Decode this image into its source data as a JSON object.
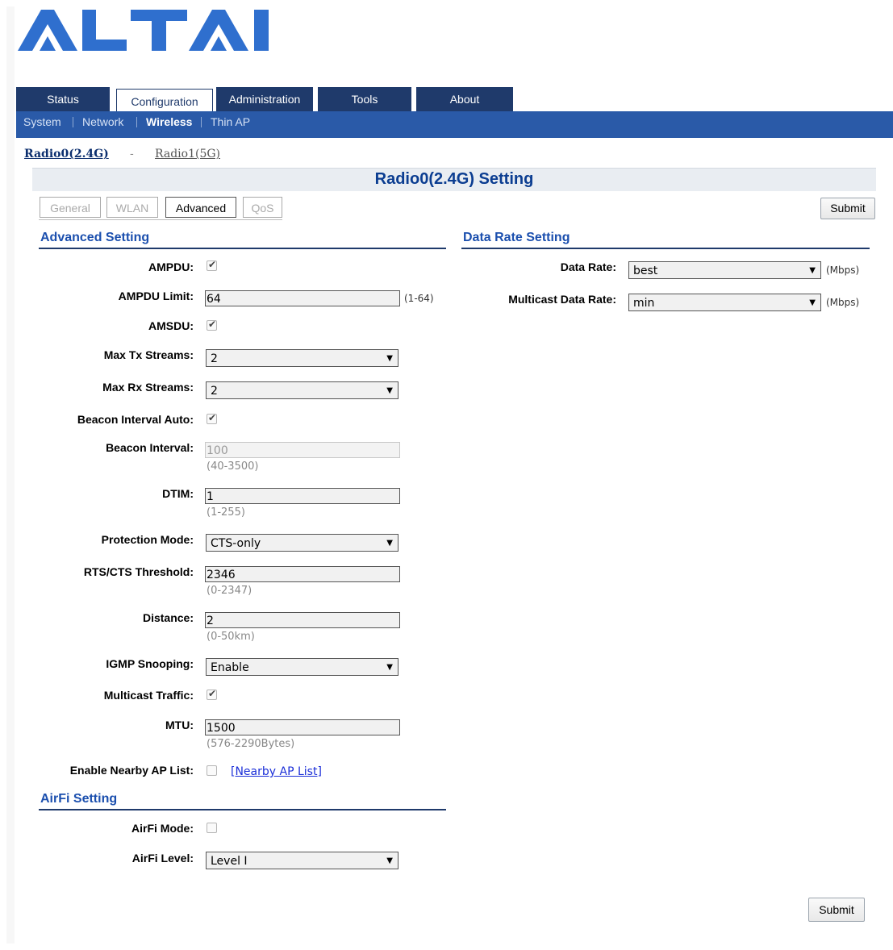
{
  "logo": {
    "text": "ALTAI",
    "color": "#2f6fce"
  },
  "main_tabs": [
    {
      "label": "Status"
    },
    {
      "label": "Configuration"
    },
    {
      "label": "Administration"
    },
    {
      "label": "Tools"
    },
    {
      "label": "About"
    }
  ],
  "active_main_tab": "Configuration",
  "sub_nav": [
    {
      "label": "System"
    },
    {
      "label": "Network"
    },
    {
      "label": "Wireless"
    },
    {
      "label": "Thin AP"
    }
  ],
  "active_sub_nav": "Wireless",
  "radio_nav": {
    "radio0": "Radio0(2.4G)",
    "separator": "-",
    "radio1": "Radio1(5G)"
  },
  "page_title": "Radio0(2.4G) Setting",
  "sub_tabs": [
    {
      "label": "General"
    },
    {
      "label": "WLAN"
    },
    {
      "label": "Advanced"
    },
    {
      "label": "QoS"
    }
  ],
  "active_sub_tab": "Advanced",
  "submit_label": "Submit",
  "advanced": {
    "heading": "Advanced Setting",
    "ampdu": {
      "label": "AMPDU:",
      "checked": true
    },
    "ampdu_limit": {
      "label": "AMPDU Limit:",
      "value": "64",
      "hint": "(1-64)"
    },
    "amsdu": {
      "label": "AMSDU:",
      "checked": true
    },
    "max_tx": {
      "label": "Max Tx Streams:",
      "value": "2"
    },
    "max_rx": {
      "label": "Max Rx Streams:",
      "value": "2"
    },
    "beacon_auto": {
      "label": "Beacon Interval Auto:",
      "checked": true
    },
    "beacon_interval": {
      "label": "Beacon Interval:",
      "value": "100",
      "hint": "(40-3500)"
    },
    "dtim": {
      "label": "DTIM:",
      "value": "1",
      "hint": "(1-255)"
    },
    "protection": {
      "label": "Protection Mode:",
      "value": "CTS-only"
    },
    "rts": {
      "label": "RTS/CTS Threshold:",
      "value": "2346",
      "hint": "(0-2347)"
    },
    "distance": {
      "label": "Distance:",
      "value": "2",
      "hint": "(0-50km)"
    },
    "igmp": {
      "label": "IGMP Snooping:",
      "value": "Enable"
    },
    "multicast_traffic": {
      "label": "Multicast Traffic:",
      "checked": true
    },
    "mtu": {
      "label": "MTU:",
      "value": "1500",
      "hint": "(576-2290Bytes)"
    },
    "nearby": {
      "label": "Enable Nearby AP List:",
      "checked": false,
      "link": "[Nearby AP List]"
    }
  },
  "airfi": {
    "heading": "AirFi Setting",
    "mode": {
      "label": "AirFi Mode:",
      "checked": false
    },
    "level": {
      "label": "AirFi Level:",
      "value": "Level I"
    }
  },
  "data_rate": {
    "heading": "Data Rate Setting",
    "rate": {
      "label": "Data Rate:",
      "value": "best",
      "unit": "(Mbps)"
    },
    "multicast": {
      "label": "Multicast Data Rate:",
      "value": "min",
      "unit": "(Mbps)"
    }
  }
}
